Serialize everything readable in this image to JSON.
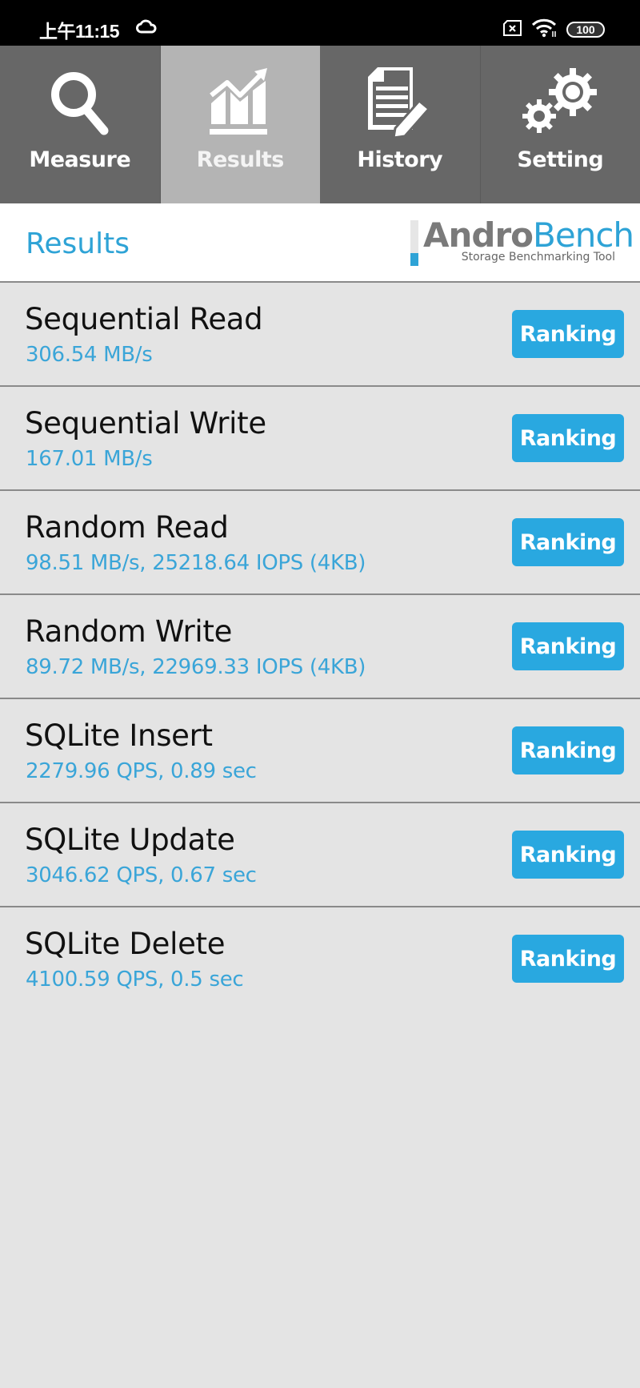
{
  "status_bar": {
    "time": "上午11:15",
    "battery": "100",
    "icons": [
      "cloud-icon",
      "sim-none-icon",
      "wifi-icon",
      "battery-icon"
    ]
  },
  "tabs": [
    {
      "label": "Measure",
      "icon": "search-icon",
      "active": false
    },
    {
      "label": "Results",
      "icon": "chart-icon",
      "active": true
    },
    {
      "label": "History",
      "icon": "document-edit-icon",
      "active": false
    },
    {
      "label": "Setting",
      "icon": "gears-icon",
      "active": false
    }
  ],
  "header": {
    "title": "Results",
    "logo": {
      "part1": "Andro",
      "part2": "Bench",
      "tagline": "Storage Benchmarking Tool"
    }
  },
  "results": [
    {
      "title": "Sequential Read",
      "value": "306.54 MB/s",
      "button": "Ranking"
    },
    {
      "title": "Sequential Write",
      "value": "167.01 MB/s",
      "button": "Ranking"
    },
    {
      "title": "Random Read",
      "value": "98.51 MB/s, 25218.64 IOPS (4KB)",
      "button": "Ranking"
    },
    {
      "title": "Random Write",
      "value": "89.72 MB/s, 22969.33 IOPS (4KB)",
      "button": "Ranking"
    },
    {
      "title": "SQLite Insert",
      "value": "2279.96 QPS, 0.89 sec",
      "button": "Ranking"
    },
    {
      "title": "SQLite Update",
      "value": "3046.62 QPS, 0.67 sec",
      "button": "Ranking"
    },
    {
      "title": "SQLite Delete",
      "value": "4100.59 QPS, 0.5 sec",
      "button": "Ranking"
    }
  ],
  "colors": {
    "accent": "#29a8e0",
    "value_text": "#3aa5d8",
    "tab_bg": "#676767",
    "tab_active_bg": "#b4b4b4",
    "list_bg": "#e4e4e4"
  }
}
